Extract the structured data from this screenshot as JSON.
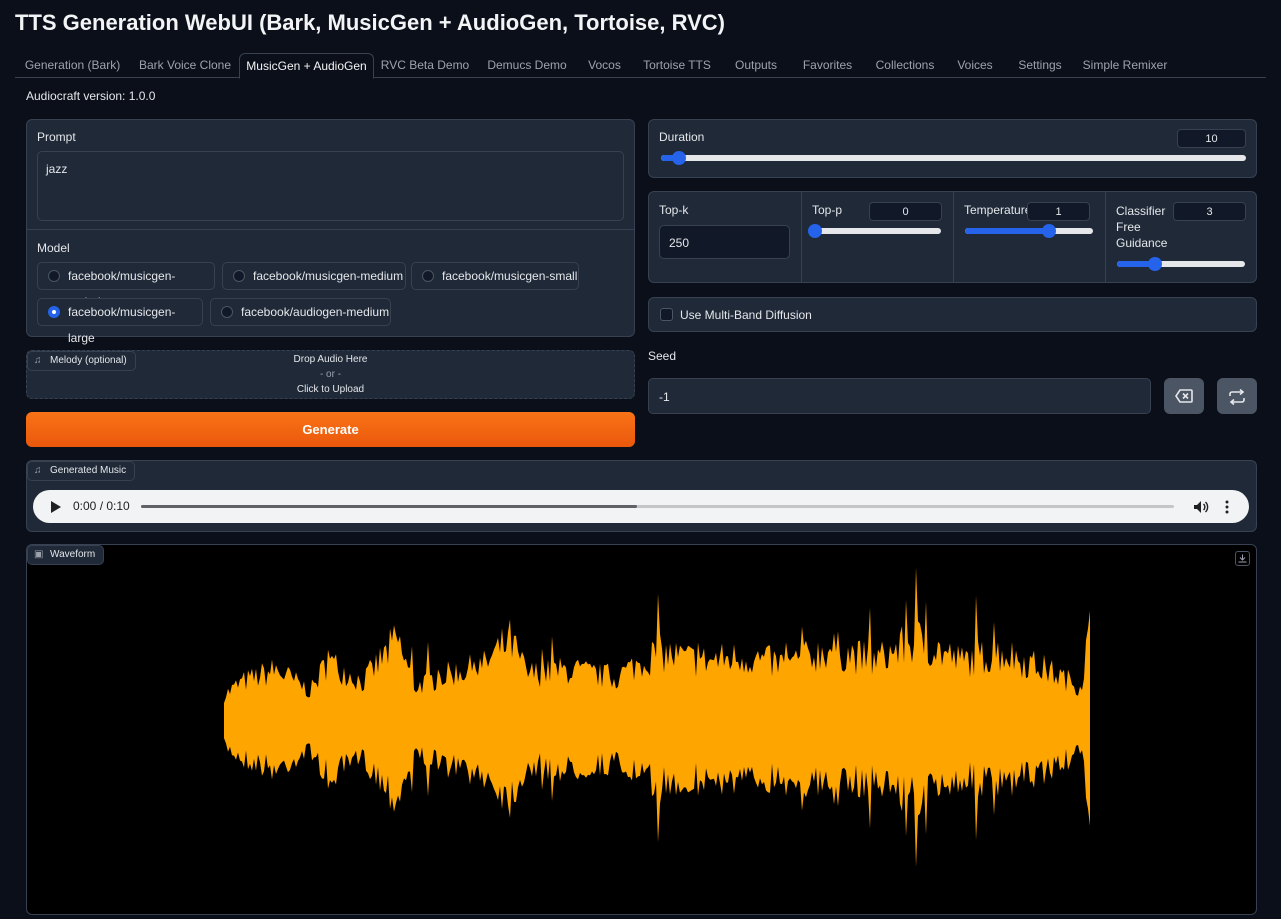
{
  "app": {
    "title": "TTS Generation WebUI (Bark, MusicGen + AudioGen, Tortoise, RVC)"
  },
  "tabs": [
    {
      "label": "Generation (Bark)"
    },
    {
      "label": "Bark Voice Clone"
    },
    {
      "label": "MusicGen + AudioGen"
    },
    {
      "label": "RVC Beta Demo"
    },
    {
      "label": "Demucs Demo"
    },
    {
      "label": "Vocos"
    },
    {
      "label": "Tortoise TTS"
    },
    {
      "label": "Outputs"
    },
    {
      "label": "Favorites"
    },
    {
      "label": "Collections"
    },
    {
      "label": "Voices"
    },
    {
      "label": "Settings"
    },
    {
      "label": "Simple Remixer"
    }
  ],
  "active_tab": "MusicGen + AudioGen",
  "version_text": "Audiocraft version: 1.0.0",
  "prompt": {
    "label": "Prompt",
    "value": "jazz"
  },
  "model": {
    "label": "Model",
    "options": [
      {
        "label": "facebook/musicgen-melody",
        "selected": false
      },
      {
        "label": "facebook/musicgen-medium",
        "selected": false
      },
      {
        "label": "facebook/musicgen-small",
        "selected": false
      },
      {
        "label": "facebook/musicgen-large",
        "selected": true
      },
      {
        "label": "facebook/audiogen-medium",
        "selected": false
      }
    ]
  },
  "melody": {
    "label": "Melody (optional)",
    "drop_text": "Drop Audio Here",
    "or_text": "- or -",
    "click_text": "Click to Upload"
  },
  "generate_label": "Generate",
  "duration": {
    "label": "Duration",
    "value": "10",
    "fraction": 0.03
  },
  "top_k": {
    "label": "Top-k",
    "value": "250"
  },
  "top_p": {
    "label": "Top-p",
    "value": "0",
    "fraction": 0.0
  },
  "temperature": {
    "label": "Temperature",
    "value": "1",
    "fraction": 0.66
  },
  "cfg": {
    "label_lines": [
      "Classifier",
      "Free",
      "Guidance"
    ],
    "value": "3",
    "fraction": 0.3
  },
  "multiband": {
    "label": "Use Multi-Band Diffusion",
    "checked": false
  },
  "seed": {
    "label": "Seed",
    "value": "-1"
  },
  "generated_music": {
    "label": "Generated Music",
    "time": "0:00 / 0:10",
    "progress": 0.48
  },
  "waveform": {
    "label": "Waveform",
    "color": "#ffa500",
    "background": "#000000"
  },
  "colors": {
    "accent": "#2563eb",
    "generate": "#f97316",
    "bg": "#0b0f19",
    "panel": "#1f2937"
  }
}
